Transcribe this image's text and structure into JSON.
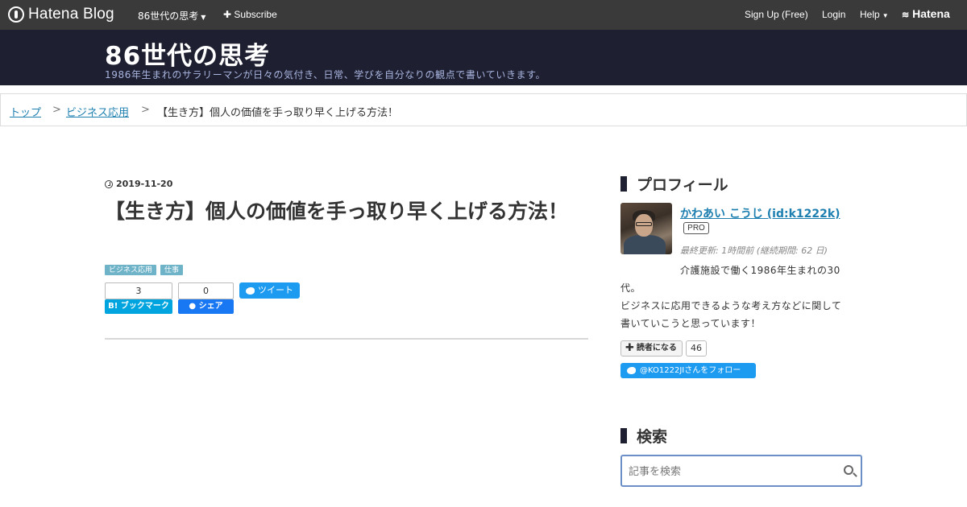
{
  "globalbar": {
    "logo_text": "Hatena Blog",
    "blog_menu": "86世代の思考",
    "subscribe": "Subscribe",
    "signup": "Sign Up (Free)",
    "login": "Login",
    "help": "Help",
    "hatena": "Hatena"
  },
  "header": {
    "title": "86世代の思考",
    "description": "1986年生まれのサラリーマンが日々の気付き、日常、学びを自分なりの観点で書いていきます。"
  },
  "breadcrumb": {
    "top": "トップ",
    "separator": ">",
    "category": "ビジネス応用",
    "current": "【生き方】個人の価値を手っ取り早く上げる方法！"
  },
  "entry": {
    "date": "2019-11-20",
    "title": "【生き方】個人の価値を手っ取り早く上げる方法！",
    "tags": [
      "ビジネス応用",
      "仕事"
    ],
    "hatebu_count": "3",
    "hatebu_label": "B! ブックマーク",
    "fb_count": "0",
    "fb_label": "シェア",
    "tweet_label": "ツイート"
  },
  "sidebar": {
    "profile_heading": "プロフィール",
    "profile_name": "かわあい こうじ (id:k1222k)",
    "pro_badge": "PRO",
    "updated": "最終更新: 1時間前 (継続期間: 62 日)",
    "desc_line1": "介護施設で働く1986年生まれの30",
    "desc_line2": "代。",
    "desc_line3": "ビジネスに応用できるような考え方などに関して",
    "desc_line4": "書いていこうと思っています！",
    "reader_label": "読者になる",
    "reader_count": "46",
    "follow_label": "@KO1222JIさんをフォロー",
    "search_heading": "検索",
    "search_placeholder": "記事を検索"
  },
  "colors": {
    "header_bg": "#1e1f30",
    "link": "#1d7fb0",
    "tag": "#6fb3c8",
    "twitter": "#1d9bf0",
    "hatebu": "#00a4de",
    "facebook": "#1877f2"
  }
}
